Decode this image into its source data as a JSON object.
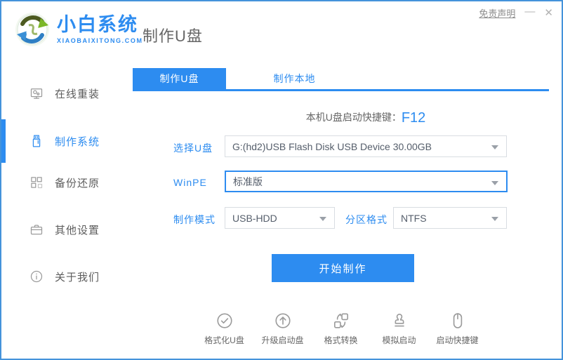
{
  "colors": {
    "accent": "#2d8cf0",
    "window_border": "#4493db",
    "text_gray": "#666666",
    "select_border": "#d9dde2"
  },
  "header": {
    "logo_name": "小白系统",
    "logo_domain": "XIAOBAIXITONG.COM",
    "page_title": "制作U盘",
    "disclaimer_link": "免责声明",
    "minimize_label": "—",
    "close_label": "✕"
  },
  "sidebar": {
    "items": [
      {
        "label": "在线重装",
        "icon": "monitor-icon",
        "active": false
      },
      {
        "label": "制作系统",
        "icon": "usb-drive-icon",
        "active": true
      },
      {
        "label": "备份还原",
        "icon": "grid-icon",
        "active": false
      },
      {
        "label": "其他设置",
        "icon": "briefcase-icon",
        "active": false
      },
      {
        "label": "关于我们",
        "icon": "info-circle-icon",
        "active": false
      }
    ]
  },
  "tabs": [
    {
      "label": "制作U盘",
      "active": true
    },
    {
      "label": "制作本地",
      "active": false
    }
  ],
  "main": {
    "hotkey_label": "本机U盘启动快捷键：",
    "hotkey_value": "F12",
    "form": {
      "usb_label": "选择U盘",
      "usb_value": "G:(hd2)USB Flash Disk USB Device 30.00GB",
      "winpe_label": "WinPE",
      "winpe_value": "标准版",
      "mode_label": "制作模式",
      "mode_value": "USB-HDD",
      "partition_label": "分区格式",
      "partition_value": "NTFS"
    },
    "start_button_label": "开始制作",
    "tools": [
      {
        "label": "格式化U盘",
        "icon": "check-circle-icon"
      },
      {
        "label": "升级启动盘",
        "icon": "arrow-up-circle-icon"
      },
      {
        "label": "格式转换",
        "icon": "convert-icon"
      },
      {
        "label": "模拟启动",
        "icon": "stamp-icon"
      },
      {
        "label": "启动快捷键",
        "icon": "mouse-icon"
      }
    ]
  }
}
